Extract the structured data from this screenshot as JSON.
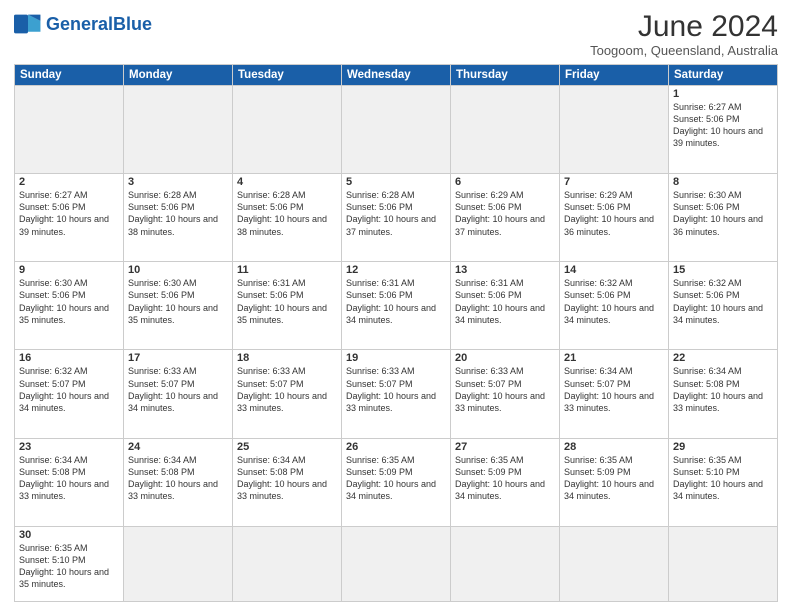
{
  "header": {
    "logo_general": "General",
    "logo_blue": "Blue",
    "month": "June 2024",
    "location": "Toogoom, Queensland, Australia"
  },
  "weekdays": [
    "Sunday",
    "Monday",
    "Tuesday",
    "Wednesday",
    "Thursday",
    "Friday",
    "Saturday"
  ],
  "weeks": [
    [
      {
        "day": "",
        "info": ""
      },
      {
        "day": "",
        "info": ""
      },
      {
        "day": "",
        "info": ""
      },
      {
        "day": "",
        "info": ""
      },
      {
        "day": "",
        "info": ""
      },
      {
        "day": "",
        "info": ""
      },
      {
        "day": "1",
        "info": "Sunrise: 6:27 AM\nSunset: 5:06 PM\nDaylight: 10 hours\nand 39 minutes."
      }
    ],
    [
      {
        "day": "2",
        "info": "Sunrise: 6:27 AM\nSunset: 5:06 PM\nDaylight: 10 hours\nand 39 minutes."
      },
      {
        "day": "3",
        "info": "Sunrise: 6:28 AM\nSunset: 5:06 PM\nDaylight: 10 hours\nand 38 minutes."
      },
      {
        "day": "4",
        "info": "Sunrise: 6:28 AM\nSunset: 5:06 PM\nDaylight: 10 hours\nand 38 minutes."
      },
      {
        "day": "5",
        "info": "Sunrise: 6:28 AM\nSunset: 5:06 PM\nDaylight: 10 hours\nand 37 minutes."
      },
      {
        "day": "6",
        "info": "Sunrise: 6:29 AM\nSunset: 5:06 PM\nDaylight: 10 hours\nand 37 minutes."
      },
      {
        "day": "7",
        "info": "Sunrise: 6:29 AM\nSunset: 5:06 PM\nDaylight: 10 hours\nand 36 minutes."
      },
      {
        "day": "8",
        "info": "Sunrise: 6:30 AM\nSunset: 5:06 PM\nDaylight: 10 hours\nand 36 minutes."
      }
    ],
    [
      {
        "day": "9",
        "info": "Sunrise: 6:30 AM\nSunset: 5:06 PM\nDaylight: 10 hours\nand 35 minutes."
      },
      {
        "day": "10",
        "info": "Sunrise: 6:30 AM\nSunset: 5:06 PM\nDaylight: 10 hours\nand 35 minutes."
      },
      {
        "day": "11",
        "info": "Sunrise: 6:31 AM\nSunset: 5:06 PM\nDaylight: 10 hours\nand 35 minutes."
      },
      {
        "day": "12",
        "info": "Sunrise: 6:31 AM\nSunset: 5:06 PM\nDaylight: 10 hours\nand 34 minutes."
      },
      {
        "day": "13",
        "info": "Sunrise: 6:31 AM\nSunset: 5:06 PM\nDaylight: 10 hours\nand 34 minutes."
      },
      {
        "day": "14",
        "info": "Sunrise: 6:32 AM\nSunset: 5:06 PM\nDaylight: 10 hours\nand 34 minutes."
      },
      {
        "day": "15",
        "info": "Sunrise: 6:32 AM\nSunset: 5:06 PM\nDaylight: 10 hours\nand 34 minutes."
      }
    ],
    [
      {
        "day": "16",
        "info": "Sunrise: 6:32 AM\nSunset: 5:07 PM\nDaylight: 10 hours\nand 34 minutes."
      },
      {
        "day": "17",
        "info": "Sunrise: 6:33 AM\nSunset: 5:07 PM\nDaylight: 10 hours\nand 34 minutes."
      },
      {
        "day": "18",
        "info": "Sunrise: 6:33 AM\nSunset: 5:07 PM\nDaylight: 10 hours\nand 33 minutes."
      },
      {
        "day": "19",
        "info": "Sunrise: 6:33 AM\nSunset: 5:07 PM\nDaylight: 10 hours\nand 33 minutes."
      },
      {
        "day": "20",
        "info": "Sunrise: 6:33 AM\nSunset: 5:07 PM\nDaylight: 10 hours\nand 33 minutes."
      },
      {
        "day": "21",
        "info": "Sunrise: 6:34 AM\nSunset: 5:07 PM\nDaylight: 10 hours\nand 33 minutes."
      },
      {
        "day": "22",
        "info": "Sunrise: 6:34 AM\nSunset: 5:08 PM\nDaylight: 10 hours\nand 33 minutes."
      }
    ],
    [
      {
        "day": "23",
        "info": "Sunrise: 6:34 AM\nSunset: 5:08 PM\nDaylight: 10 hours\nand 33 minutes."
      },
      {
        "day": "24",
        "info": "Sunrise: 6:34 AM\nSunset: 5:08 PM\nDaylight: 10 hours\nand 33 minutes."
      },
      {
        "day": "25",
        "info": "Sunrise: 6:34 AM\nSunset: 5:08 PM\nDaylight: 10 hours\nand 33 minutes."
      },
      {
        "day": "26",
        "info": "Sunrise: 6:35 AM\nSunset: 5:09 PM\nDaylight: 10 hours\nand 34 minutes."
      },
      {
        "day": "27",
        "info": "Sunrise: 6:35 AM\nSunset: 5:09 PM\nDaylight: 10 hours\nand 34 minutes."
      },
      {
        "day": "28",
        "info": "Sunrise: 6:35 AM\nSunset: 5:09 PM\nDaylight: 10 hours\nand 34 minutes."
      },
      {
        "day": "29",
        "info": "Sunrise: 6:35 AM\nSunset: 5:10 PM\nDaylight: 10 hours\nand 34 minutes."
      }
    ],
    [
      {
        "day": "30",
        "info": "Sunrise: 6:35 AM\nSunset: 5:10 PM\nDaylight: 10 hours\nand 35 minutes."
      },
      {
        "day": "",
        "info": ""
      },
      {
        "day": "",
        "info": ""
      },
      {
        "day": "",
        "info": ""
      },
      {
        "day": "",
        "info": ""
      },
      {
        "day": "",
        "info": ""
      },
      {
        "day": "",
        "info": ""
      }
    ]
  ]
}
